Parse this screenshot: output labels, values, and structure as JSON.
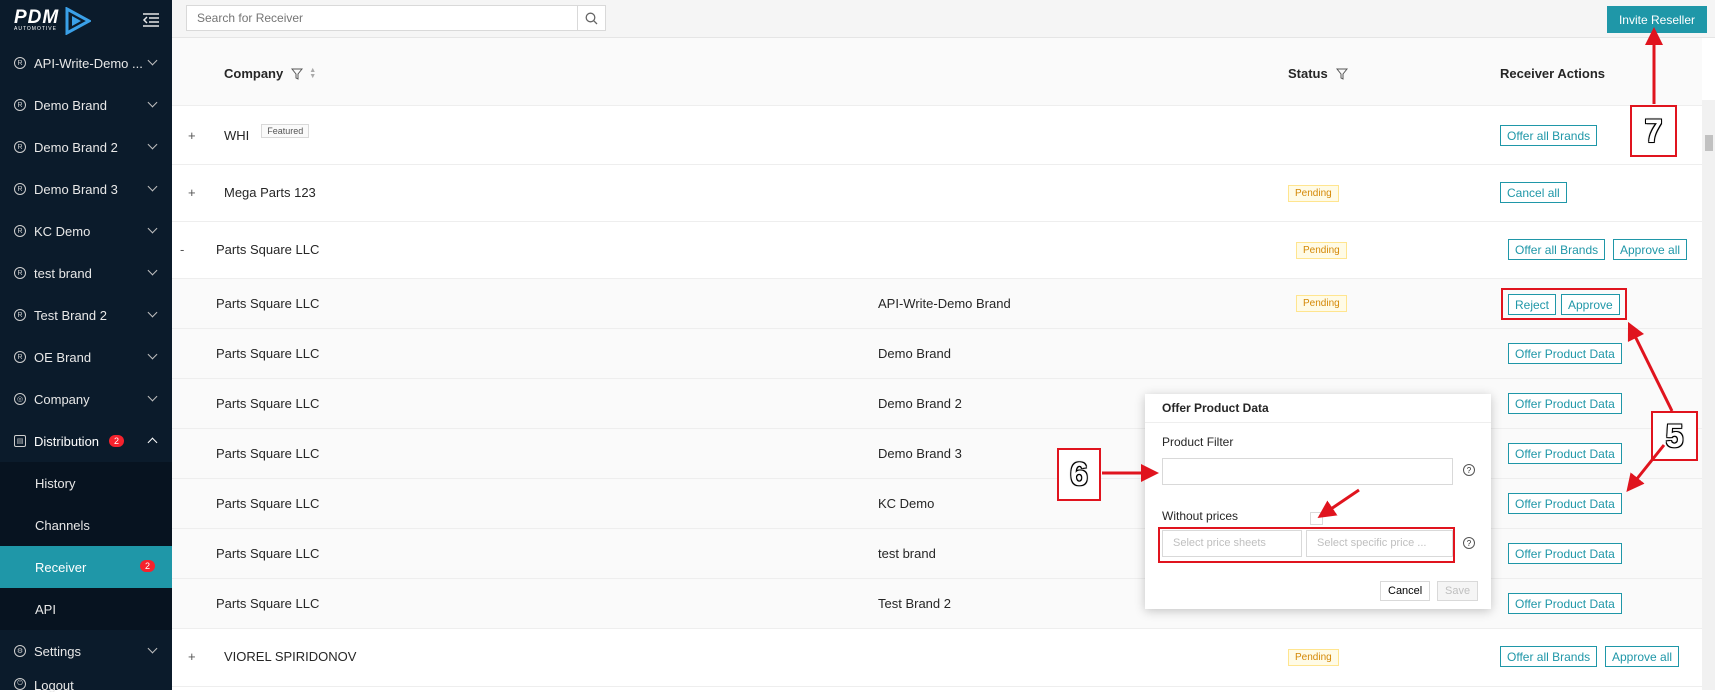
{
  "sidebar": {
    "logo": {
      "main": "PDM",
      "sub": "AUTOMOTIVE"
    },
    "items": [
      {
        "label": "API-Write-Demo ...",
        "icon": "registered-icon"
      },
      {
        "label": "Demo Brand",
        "icon": "registered-icon"
      },
      {
        "label": "Demo Brand 2",
        "icon": "registered-icon"
      },
      {
        "label": "Demo Brand 3",
        "icon": "registered-icon"
      },
      {
        "label": "KC Demo",
        "icon": "registered-icon"
      },
      {
        "label": "test brand",
        "icon": "registered-icon"
      },
      {
        "label": "Test Brand 2",
        "icon": "registered-icon"
      },
      {
        "label": "OE Brand",
        "icon": "registered-icon"
      },
      {
        "label": "Company",
        "icon": "globe-icon"
      }
    ],
    "distribution": {
      "label": "Distribution",
      "badge": "2"
    },
    "sub_items": [
      {
        "label": "History"
      },
      {
        "label": "Channels"
      },
      {
        "label": "Receiver",
        "badge": "2"
      },
      {
        "label": "API"
      }
    ],
    "settings": {
      "label": "Settings"
    },
    "logout": {
      "label": "Logout"
    }
  },
  "topbar": {
    "search_placeholder": "Search for Receiver",
    "invite_label": "Invite Reseller"
  },
  "table": {
    "headers": {
      "company": "Company",
      "status": "Status",
      "actions": "Receiver Actions"
    },
    "rows": [
      {
        "expander": "+",
        "company": "WHI",
        "tag": "Featured",
        "actions": [
          "Offer all Brands"
        ]
      },
      {
        "expander": "+",
        "company": "Mega Parts 123",
        "status": "Pending",
        "actions": [
          "Cancel all"
        ]
      },
      {
        "expander": "-",
        "company": "Parts Square LLC",
        "status": "Pending",
        "actions": [
          "Offer all Brands",
          "Approve all"
        ]
      },
      {
        "company": "Parts Square LLC",
        "brand": "API-Write-Demo Brand",
        "status": "Pending",
        "actions": [
          "Reject",
          "Approve"
        ]
      },
      {
        "company": "Parts Square LLC",
        "brand": "Demo Brand",
        "actions": [
          "Offer Product Data"
        ]
      },
      {
        "company": "Parts Square LLC",
        "brand": "Demo Brand 2",
        "actions": [
          "Offer Product Data"
        ]
      },
      {
        "company": "Parts Square LLC",
        "brand": "Demo Brand 3",
        "actions": [
          "Offer Product Data"
        ]
      },
      {
        "company": "Parts Square LLC",
        "brand": "KC Demo",
        "actions": [
          "Offer Product Data"
        ]
      },
      {
        "company": "Parts Square LLC",
        "brand": "test brand",
        "actions": [
          "Offer Product Data"
        ]
      },
      {
        "company": "Parts Square LLC",
        "brand": "Test Brand 2",
        "actions": [
          "Offer Product Data"
        ]
      },
      {
        "expander": "+",
        "company": "VIOREL SPIRIDONOV",
        "status": "Pending",
        "actions": [
          "Offer all Brands",
          "Approve all"
        ]
      }
    ]
  },
  "popover": {
    "title": "Offer Product Data",
    "product_filter_label": "Product Filter",
    "without_prices_label": "Without prices",
    "price_sheets_placeholder": "Select price sheets",
    "specific_price_placeholder": "Select specific price ...",
    "cancel_label": "Cancel",
    "save_label": "Save"
  },
  "annotations": {
    "callout_5": "5",
    "callout_6": "6",
    "callout_7": "7"
  },
  "colors": {
    "accent": "#1f97a8",
    "sidebar": "#0b1b2b",
    "annotation_red": "#e0141e",
    "pending": "#d48806"
  }
}
